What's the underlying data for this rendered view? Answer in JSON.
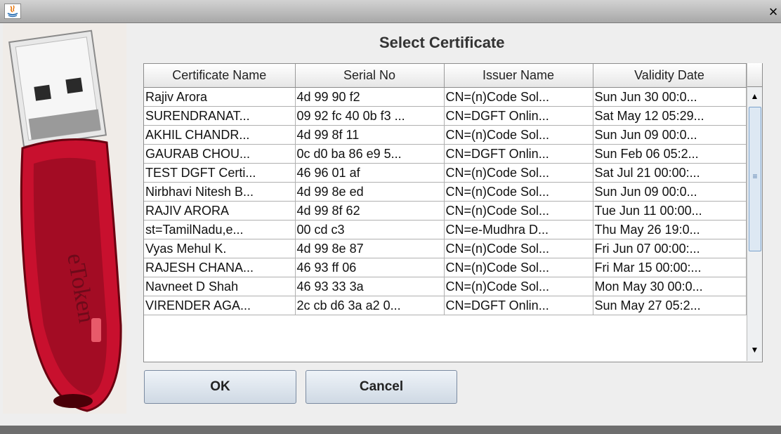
{
  "window": {
    "close_label": "×",
    "app_icon": "java-icon"
  },
  "dialog": {
    "title": "Select Certificate"
  },
  "table": {
    "columns": [
      "Certificate Name",
      "Serial No",
      "Issuer Name",
      "Validity Date"
    ],
    "rows": [
      [
        "Rajiv Arora",
        "4d 99 90 f2",
        "CN=(n)Code Sol...",
        "Sun Jun 30 00:0..."
      ],
      [
        "SURENDRANAT...",
        "09 92 fc 40 0b f3 ...",
        "CN=DGFT Onlin...",
        "Sat May 12 05:29..."
      ],
      [
        "AKHIL CHANDR...",
        "4d 99 8f 11",
        "CN=(n)Code Sol...",
        "Sun Jun 09 00:0..."
      ],
      [
        "GAURAB CHOU...",
        "0c d0 ba 86 e9 5...",
        "CN=DGFT Onlin...",
        "Sun Feb 06 05:2..."
      ],
      [
        "TEST DGFT Certi...",
        "46 96 01 af",
        "CN=(n)Code Sol...",
        "Sat Jul 21 00:00:..."
      ],
      [
        "Nirbhavi Nitesh B...",
        "4d 99 8e ed",
        "CN=(n)Code Sol...",
        "Sun Jun 09 00:0..."
      ],
      [
        "RAJIV ARORA",
        "4d 99 8f 62",
        "CN=(n)Code Sol...",
        "Tue Jun 11 00:00..."
      ],
      [
        "st=TamilNadu,e...",
        "00 cd c3",
        "CN=e-Mudhra D...",
        "Thu May 26 19:0..."
      ],
      [
        "Vyas Mehul K.",
        "4d 99 8e 87",
        "CN=(n)Code Sol...",
        "Fri Jun 07 00:00:..."
      ],
      [
        "RAJESH CHANA...",
        "46 93 ff 06",
        "CN=(n)Code Sol...",
        "Fri Mar 15 00:00:..."
      ],
      [
        "Navneet D Shah",
        "46 93 33 3a",
        "CN=(n)Code Sol...",
        "Mon May 30 00:0..."
      ],
      [
        "VIRENDER AGA...",
        "2c cb d6 3a a2 0...",
        "CN=DGFT Onlin...",
        "Sun May 27 05:2..."
      ]
    ]
  },
  "scrollbar": {
    "up_icon": "▲",
    "down_icon": "▼",
    "grip": "≡"
  },
  "buttons": {
    "ok": "OK",
    "cancel": "Cancel"
  },
  "token_image": {
    "brand": "eToken",
    "accent_color": "#c8102e"
  }
}
